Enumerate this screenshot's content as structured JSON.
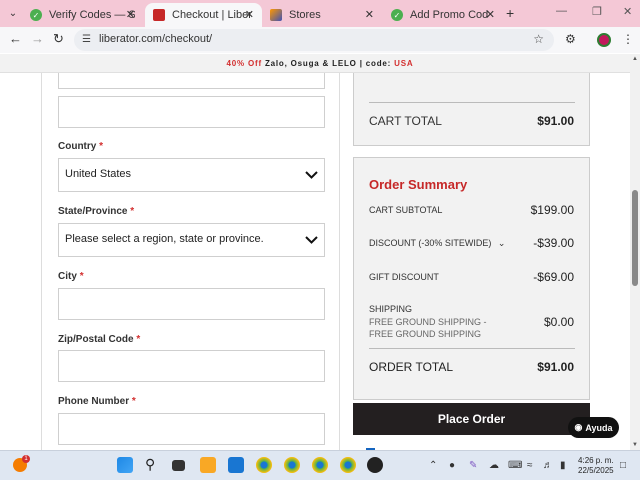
{
  "browser": {
    "tabs": [
      {
        "title": "Verify Codes — Simply",
        "favicon": "green-check-icon",
        "active": false
      },
      {
        "title": "Checkout | Liberator.co",
        "favicon": "liberator-logo-icon",
        "active": true
      },
      {
        "title": "Stores",
        "favicon": "stores-icon",
        "active": false
      },
      {
        "title": "Add Promo Codes — S",
        "favicon": "green-check-icon",
        "active": false
      }
    ],
    "url": "liberator.com/checkout/"
  },
  "promo_banner": {
    "highlight": "40% Off",
    "text": "Zalo, Osuga & LELO | code:",
    "code": "USA"
  },
  "form": {
    "country_label": "Country",
    "country_value": "United States",
    "state_label": "State/Province",
    "state_value": "Please select a region, state or province.",
    "city_label": "City",
    "zip_label": "Zip/Postal Code",
    "phone_label": "Phone Number",
    "required_mark": "*"
  },
  "cart": {
    "total_label": "CART TOTAL",
    "total_value": "$91.00"
  },
  "summary": {
    "title": "Order Summary",
    "subtotal_label": "CART SUBTOTAL",
    "subtotal_value": "$199.00",
    "discount_label": "DISCOUNT (-30% SITEWIDE)",
    "discount_value": "-$39.00",
    "gift_label": "GIFT DISCOUNT",
    "gift_value": "-$69.00",
    "shipping_label": "SHIPPING",
    "shipping_detail": "FREE GROUND SHIPPING - FREE GROUND SHIPPING",
    "shipping_value": "$0.00",
    "order_total_label": "ORDER TOTAL",
    "order_total_value": "$91.00"
  },
  "place_order_label": "Place Order",
  "help_button_label": "Ayuda",
  "taskbar": {
    "time": "4:26 p. m.",
    "date": "22/5/2025",
    "weather_badge": "1"
  },
  "colors": {
    "accent_red": "#c62828",
    "tabstrip_pink": "#f4c8d6",
    "button_dark": "#231f20"
  }
}
